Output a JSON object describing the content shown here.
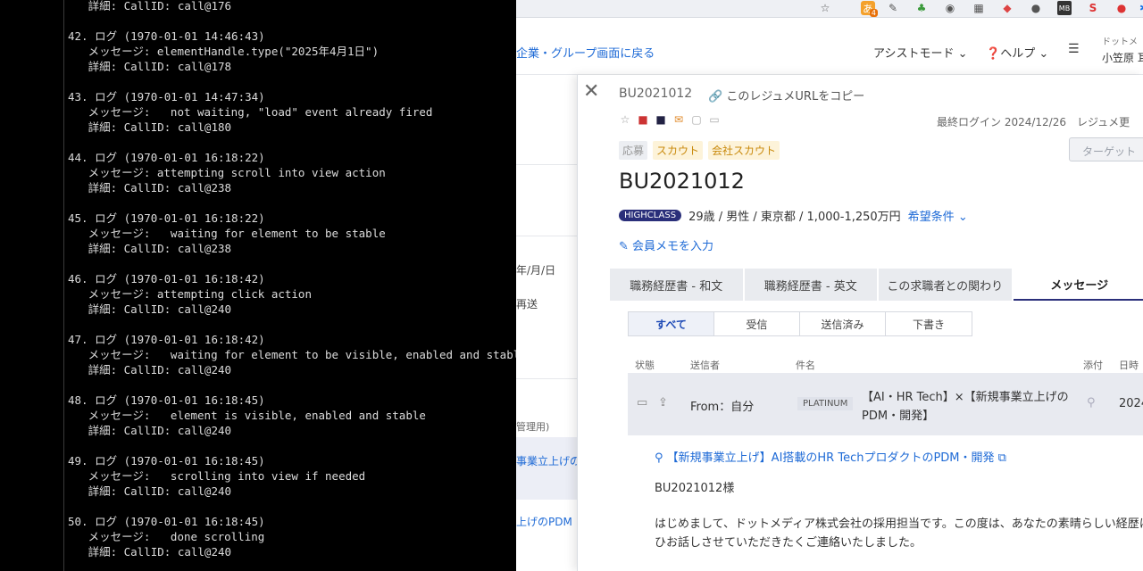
{
  "terminal": {
    "lines": [
      "   詳細: CallID: call@176",
      "",
      "42. ログ (1970-01-01 14:46:43)",
      "   メッセージ: elementHandle.type(\"2025年4月1日\")",
      "   詳細: CallID: call@178",
      "",
      "43. ログ (1970-01-01 14:47:34)",
      "   メッセージ:   not waiting, \"load\" event already fired",
      "   詳細: CallID: call@180",
      "",
      "44. ログ (1970-01-01 16:18:22)",
      "   メッセージ: attempting scroll into view action",
      "   詳細: CallID: call@238",
      "",
      "45. ログ (1970-01-01 16:18:22)",
      "   メッセージ:   waiting for element to be stable",
      "   詳細: CallID: call@238",
      "",
      "46. ログ (1970-01-01 16:18:42)",
      "   メッセージ: attempting click action",
      "   詳細: CallID: call@240",
      "",
      "47. ログ (1970-01-01 16:18:42)",
      "   メッセージ:   waiting for element to be visible, enabled and stable",
      "   詳細: CallID: call@240",
      "",
      "48. ログ (1970-01-01 16:18:45)",
      "   メッセージ:   element is visible, enabled and stable",
      "   詳細: CallID: call@240",
      "",
      "49. ログ (1970-01-01 16:18:45)",
      "   メッセージ:   scrolling into view if needed",
      "   詳細: CallID: call@240",
      "",
      "50. ログ (1970-01-01 16:18:45)",
      "   メッセージ:   done scrolling",
      "   詳細: CallID: call@240"
    ]
  },
  "browser": {
    "extensions": [
      "star-icon",
      "translate-icon",
      "pen-icon",
      "puzzle-icon",
      "camera-icon",
      "grid-icon",
      "color-icon",
      "owl-icon",
      "mb-icon",
      "s-icon",
      "record-icon",
      "extensions-icon"
    ],
    "ext_badge": "4",
    "header": {
      "back_link": "企業・グループ画面に戻る",
      "assist_mode": "アシストモード",
      "help": "ヘルプ",
      "user_org": "ドットメ",
      "user_name": "小笠原 耳"
    },
    "bg_page": {
      "date_placeholder": "年/月/日",
      "resend": "再送",
      "admin": "管理用)",
      "link1": "事業立上げの",
      "link2": "上げのPDM"
    },
    "drawer": {
      "resume_id": "BU2021012",
      "copy_url": "このレジュメURLをコピー",
      "last_login": "最終ログイン 2024/12/26　レジュメ更",
      "tags": [
        "応募",
        "スカウト",
        "会社スカウト"
      ],
      "target_button": "ターゲット",
      "candidate_id": "BU2021012",
      "highclass": "HIGHCLASS",
      "profile": "29歳 / 男性 / 東京都 / 1,000-1,250万円",
      "preferences": "希望条件",
      "memo": "会員メモを入力",
      "tabs": [
        "職務経歴書 - 和文",
        "職務経歴書 - 英文",
        "この求職者との関わり",
        "メッセージ"
      ],
      "subtabs": [
        "すべて",
        "受信",
        "送信済み",
        "下書き"
      ],
      "columns": [
        "状態",
        "送信者",
        "件名",
        "添付",
        "日時"
      ],
      "message": {
        "sender": "From：自分",
        "badge": "PLATINUM",
        "subject_line1": "【AI・HR Tech】×【新規事業立上げの",
        "subject_line2": "PDM・開発】",
        "date": "2024"
      },
      "body": {
        "attachment": "【新規事業立上げ】AI搭載のHR TechプロダクトのPDM・開発",
        "greeting": "BU2021012様",
        "para1": "はじめまして、ドットメディア株式会社の採用担当です。この度は、あなたの素晴らしい経歴に注目",
        "para2": "ひお話しさせていただきたくご連絡いたしました。"
      }
    }
  }
}
